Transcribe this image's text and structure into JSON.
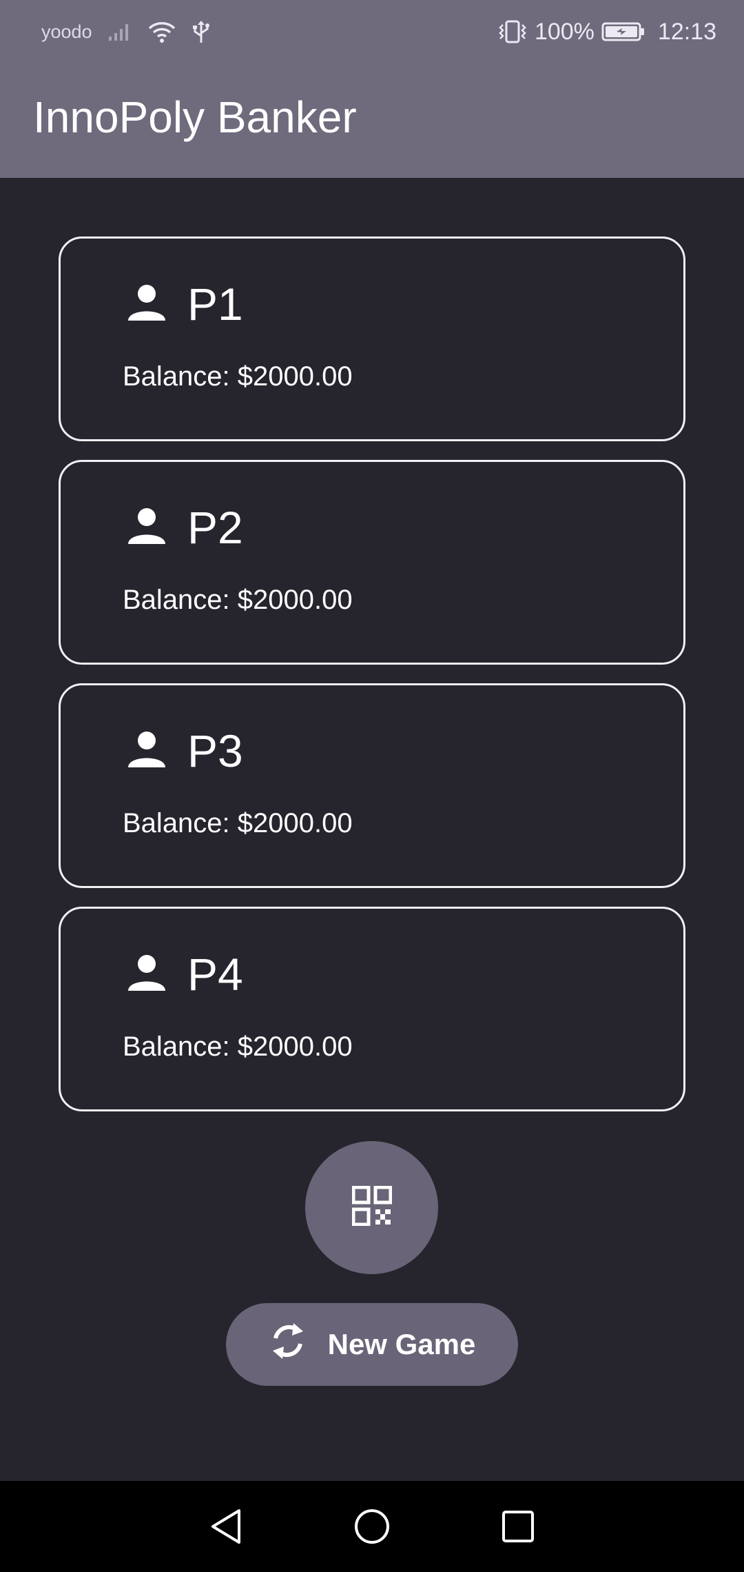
{
  "status_bar": {
    "carrier": "yoodo",
    "battery_percent": "100%",
    "time": "12:13"
  },
  "app_bar": {
    "title": "InnoPoly Banker"
  },
  "players": [
    {
      "name": "P1",
      "balance": "Balance: $2000.00"
    },
    {
      "name": "P2",
      "balance": "Balance: $2000.00"
    },
    {
      "name": "P3",
      "balance": "Balance: $2000.00"
    },
    {
      "name": "P4",
      "balance": "Balance: $2000.00"
    }
  ],
  "actions": {
    "scan_icon": "qr-code-icon",
    "new_game_label": "New Game",
    "new_game_icon": "refresh-icon"
  },
  "nav": {
    "back_icon": "back-triangle-icon",
    "home_icon": "home-circle-icon",
    "recents_icon": "recents-square-icon"
  },
  "colors": {
    "app_bar": "#6f6a7c",
    "background": "#26242d",
    "button": "#6a6478",
    "card_border": "#f2f0f5"
  }
}
